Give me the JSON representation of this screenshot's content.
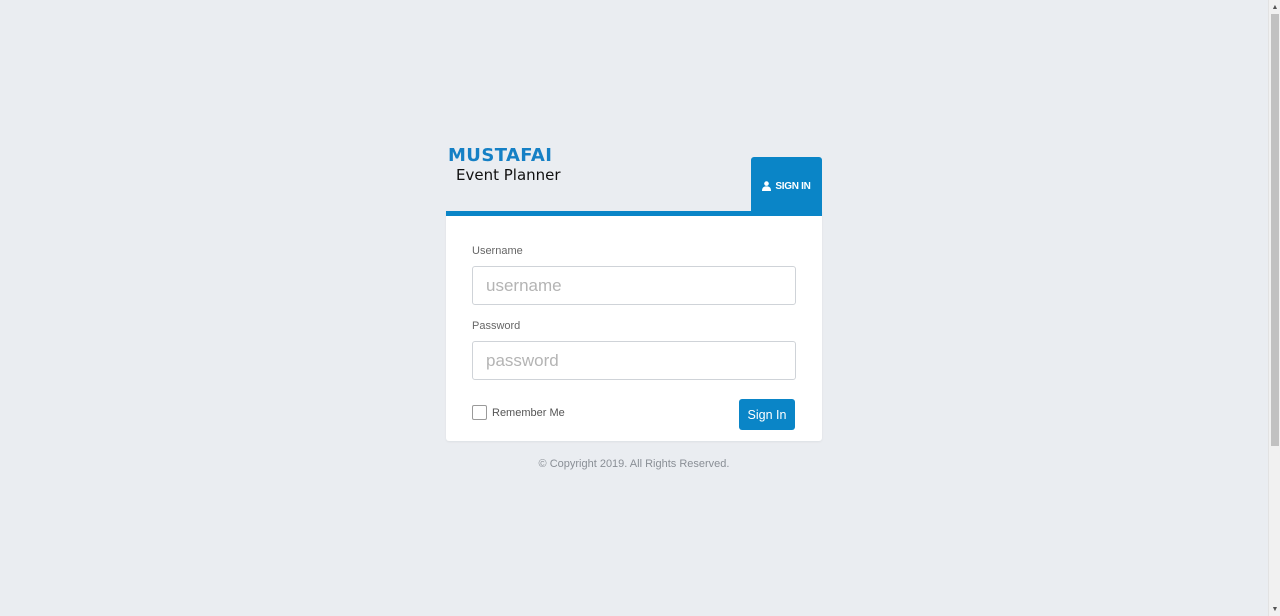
{
  "logo": {
    "brand": "MUSTAFAI",
    "subtitle": "Event Planner",
    "brand_color": "#1580c5"
  },
  "tab": {
    "label": "SIGN IN",
    "icon": "user-icon"
  },
  "form": {
    "username_label": "Username",
    "username_placeholder": "username",
    "username_value": "",
    "password_label": "Password",
    "password_placeholder": "password",
    "password_value": "",
    "remember_label": "Remember Me",
    "remember_checked": false,
    "submit_label": "Sign In"
  },
  "footer": {
    "copyright": "© Copyright 2019. All Rights Reserved."
  },
  "colors": {
    "accent": "#0a85c7",
    "background": "#eaedf1"
  }
}
